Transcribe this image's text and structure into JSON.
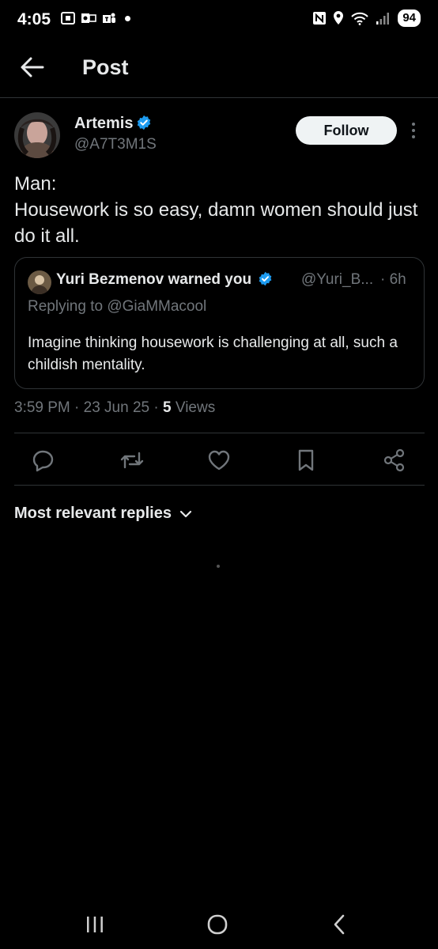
{
  "status_bar": {
    "time": "4:05",
    "battery": "94",
    "left_icons": [
      "screenshot-icon",
      "outlook-icon",
      "teams-icon",
      "notification-dot-icon"
    ],
    "right_icons": [
      "nfc-icon",
      "location-icon",
      "wifi-icon",
      "signal-icon"
    ]
  },
  "header": {
    "title": "Post",
    "back_icon": "back-arrow-icon"
  },
  "post": {
    "author_name": "Artemis",
    "author_handle": "@A7T3M1S",
    "verified_icon": "verified-badge-icon",
    "follow_label": "Follow",
    "more_icon": "more-vertical-icon",
    "text": "Man:\nHousework is so easy, damn women should just do it all.",
    "quote": {
      "name": "Yuri Bezmenov warned you",
      "handle": "@Yuri_B...",
      "time": "· 6h",
      "replying_to": "Replying to @GiaMMacool",
      "text": "Imagine thinking housework is challenging at all, such a childish mentality."
    },
    "time_date": "3:59 PM · 23 Jun 25 ·",
    "views_count": "5",
    "views_label": "Views"
  },
  "actions": [
    "reply-icon",
    "repost-icon",
    "like-icon",
    "bookmark-icon",
    "share-icon"
  ],
  "replies_sort": {
    "label": "Most relevant replies",
    "icon": "chevron-down-icon"
  },
  "nav_bar": [
    "recents-icon",
    "home-icon",
    "back-icon"
  ],
  "colors": {
    "background": "#000000",
    "text": "#e7e9ea",
    "muted": "#71767b",
    "border": "#2f3336",
    "verified": "#1d9bf0",
    "follow_bg": "#eff3f4"
  }
}
